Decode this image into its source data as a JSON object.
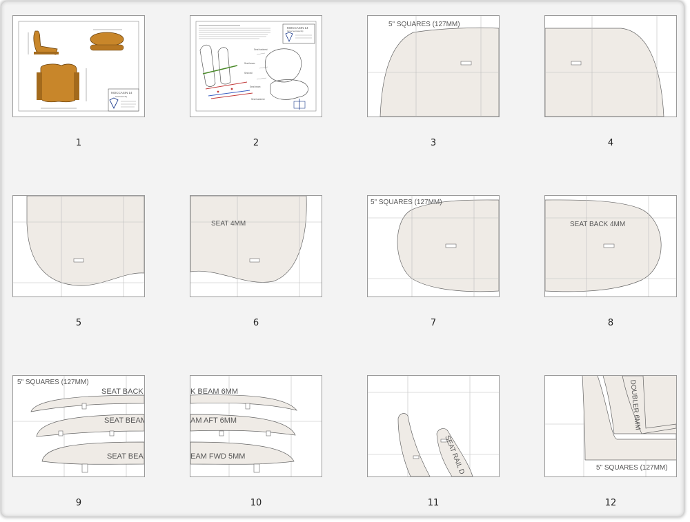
{
  "pages": [
    {
      "number": "1"
    },
    {
      "number": "2"
    },
    {
      "number": "3",
      "labels": {
        "squares": "5\" SQUARES (127MM)"
      }
    },
    {
      "number": "4"
    },
    {
      "number": "5"
    },
    {
      "number": "6",
      "labels": {
        "seat": "SEAT 4MM"
      }
    },
    {
      "number": "7",
      "labels": {
        "squares": "5\" SQUARES (127MM)"
      }
    },
    {
      "number": "8",
      "labels": {
        "seatback": "SEAT BACK 4MM"
      }
    },
    {
      "number": "9",
      "labels": {
        "squares": "5\" SQUARES (127MM)",
        "l1": "SEAT BACK B",
        "l2": "SEAT BEAM",
        "l3": "SEAT BEAM"
      }
    },
    {
      "number": "10",
      "labels": {
        "l1": "K BEAM 6MM",
        "l2": "AM AFT 6MM",
        "l3": "EAM FWD 5MM"
      }
    },
    {
      "number": "11",
      "labels": {
        "rail": "SEAT RAIL D"
      }
    },
    {
      "number": "12",
      "labels": {
        "doubler": "DOUBLER 6MM",
        "squares": "5\" SQUARES (127MM)"
      }
    }
  ],
  "cover": {
    "title": "MOCCASIN 14",
    "subtitle": "Seat Assembly"
  },
  "instructions": {
    "title": "MOCCASIN 14",
    "subtitle": "Canoe Seat Assembly",
    "callouts": [
      "Seat backrest",
      "Seat beam",
      "Seat rail",
      "Seat beam",
      "Seat backrest"
    ]
  },
  "colors": {
    "part_fill": "#efebe6",
    "part_stroke": "#666666",
    "grid_line": "#bdbdbd",
    "seat_wood": "#c8862a",
    "logo_blue": "#1b3a8c"
  }
}
